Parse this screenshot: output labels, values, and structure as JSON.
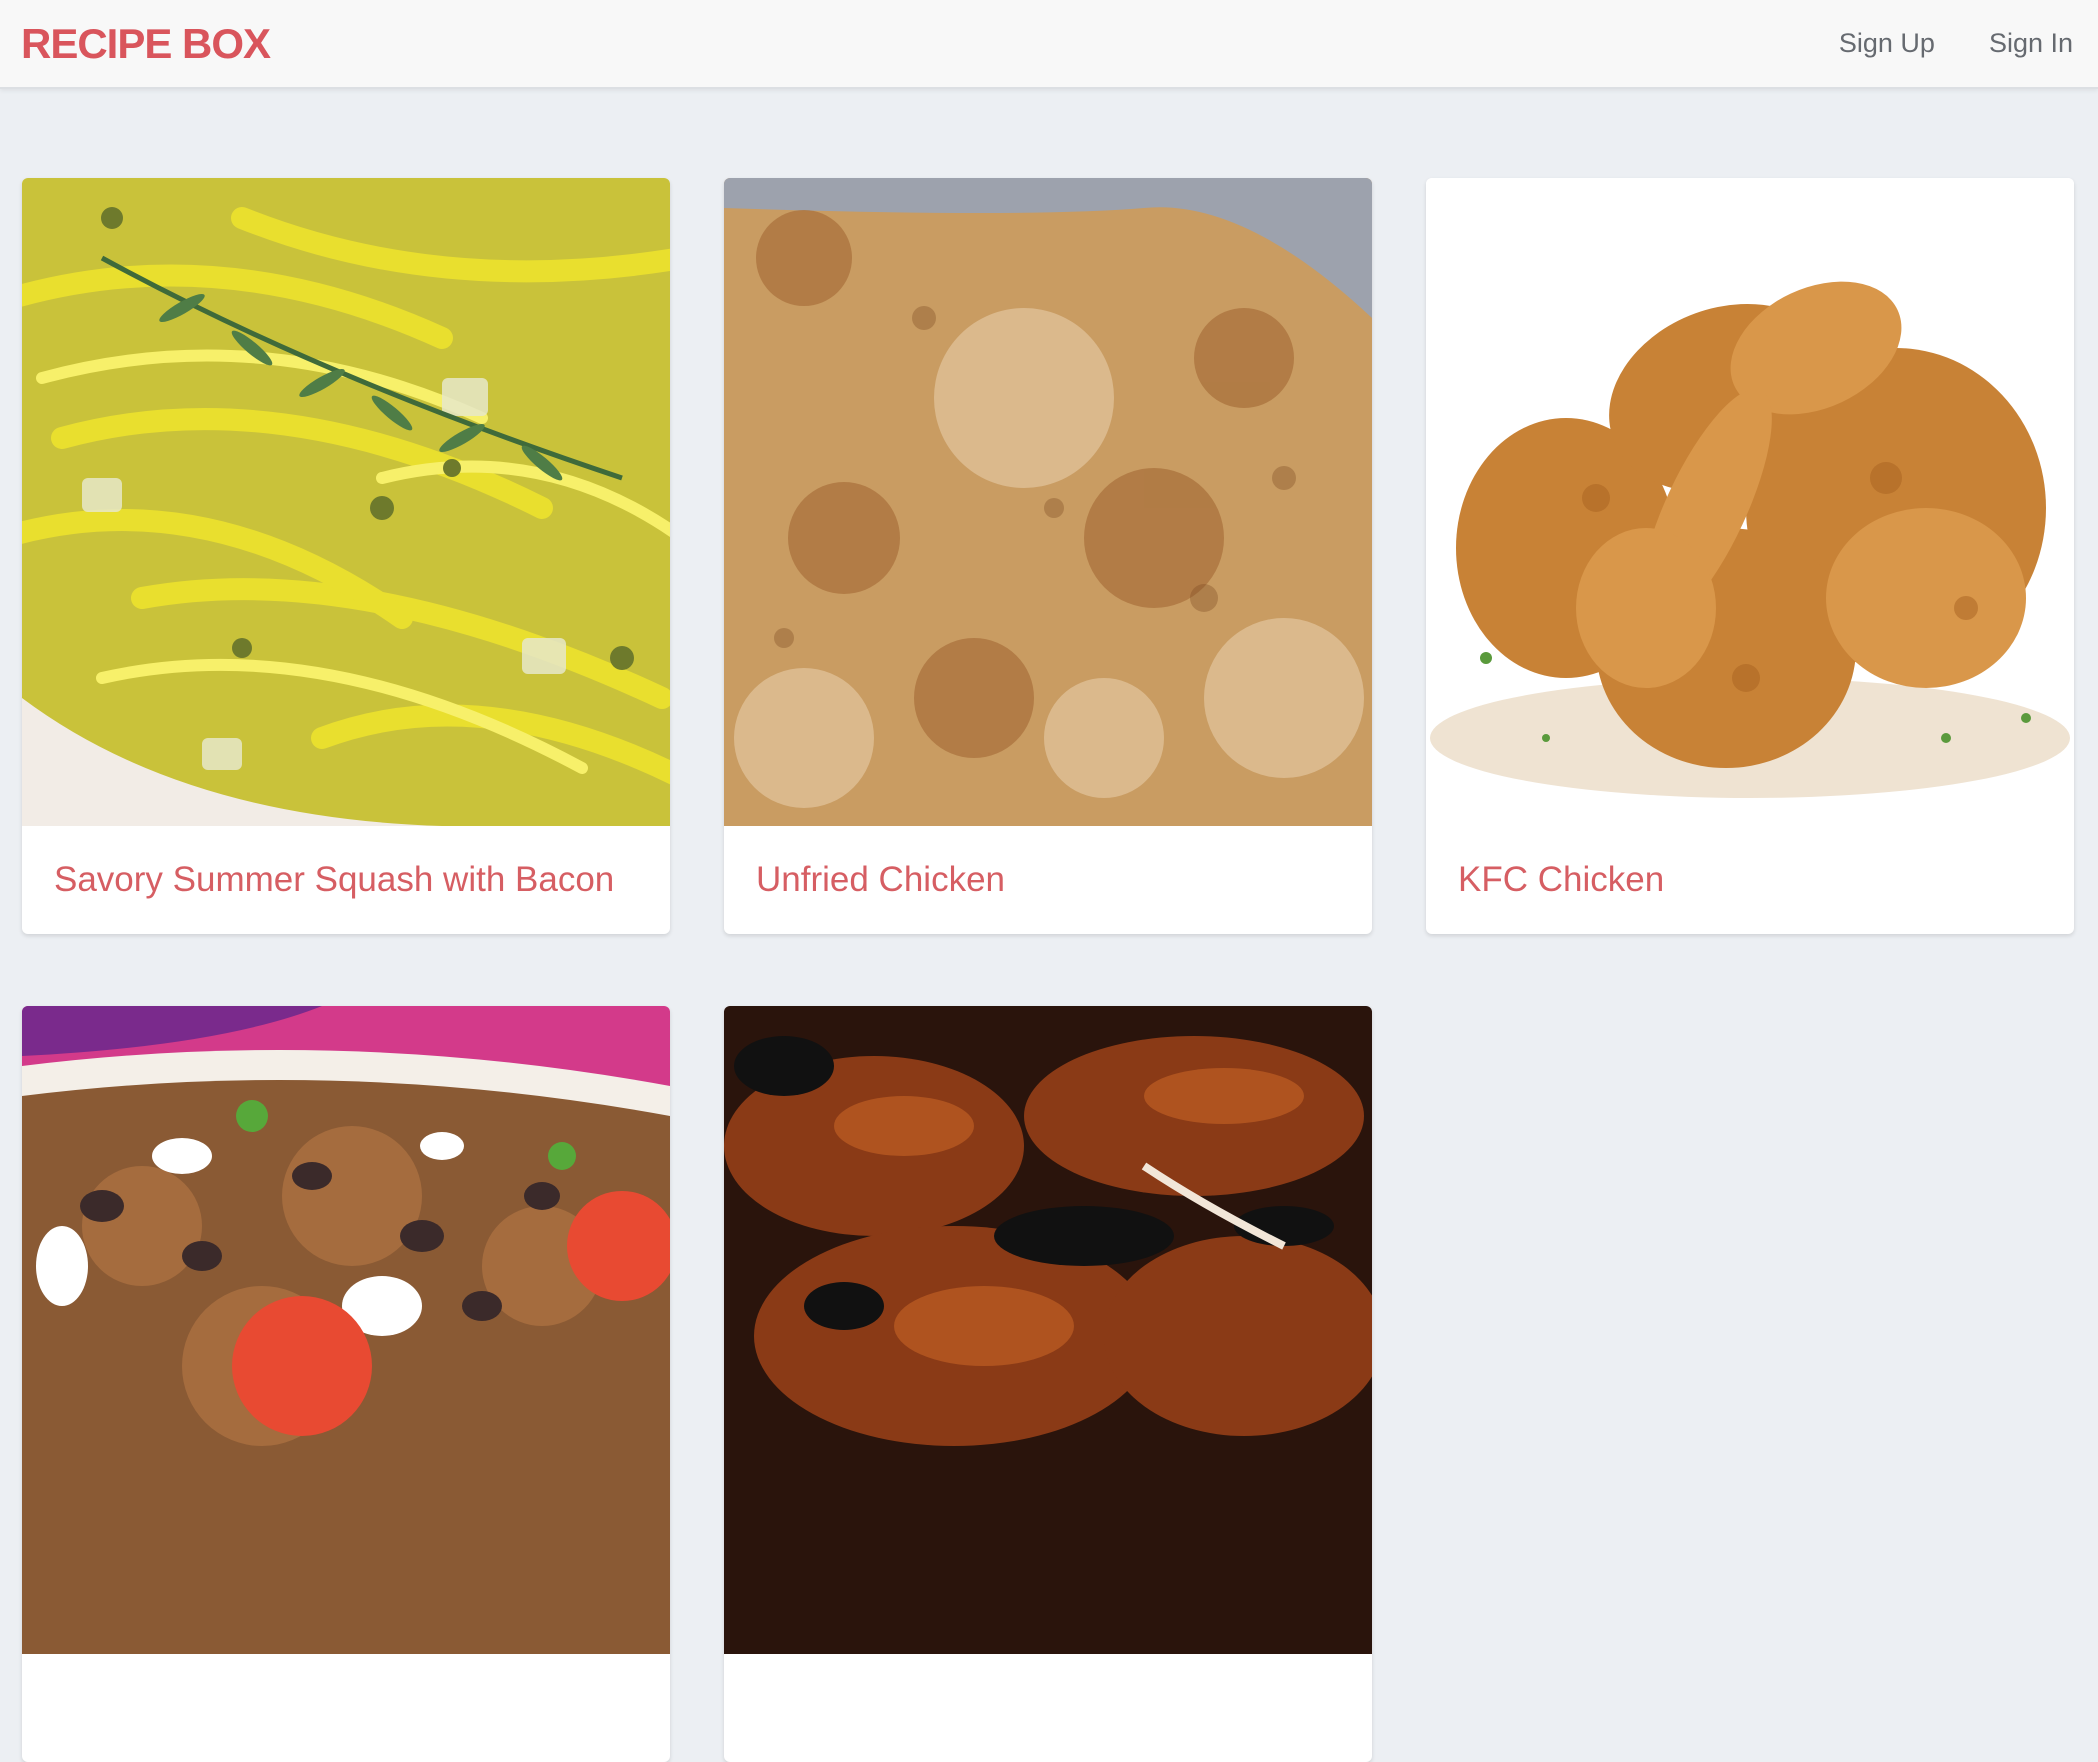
{
  "app": {
    "brand": "RECIPE BOX"
  },
  "nav": {
    "sign_up": "Sign Up",
    "sign_in": "Sign In"
  },
  "recipes": [
    {
      "title": "Savory Summer Squash with Bacon",
      "photo": "squash-noodles-photo"
    },
    {
      "title": "Unfried Chicken",
      "photo": "breaded-chicken-photo"
    },
    {
      "title": "KFC Chicken",
      "photo": "fried-chicken-photo"
    },
    {
      "title": "",
      "photo": "bean-salad-photo"
    },
    {
      "title": "",
      "photo": "grilled-chicken-photo"
    }
  ],
  "colors": {
    "accent": "#d9555c",
    "background": "#eceff3",
    "nav_text": "#666a70"
  }
}
